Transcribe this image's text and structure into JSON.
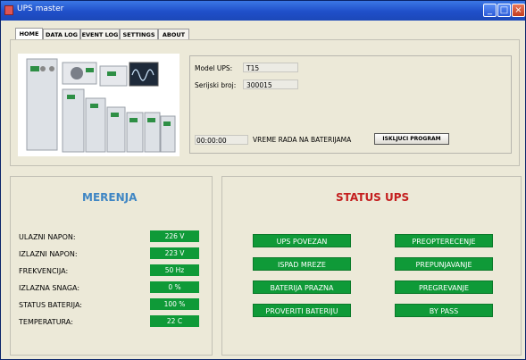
{
  "window": {
    "title": "UPS master"
  },
  "tabs": [
    "HOME",
    "DATA LOG",
    "EVENT LOG",
    "SETTINGS",
    "ABOUT"
  ],
  "info": {
    "model_label": "Model UPS:",
    "model_value": "T15",
    "serial_label": "Serijski broj:",
    "serial_value": "300015",
    "battery_time": "00:00:00",
    "battery_time_label": "VREME RADA NA BATERIJAMA",
    "exit_button": "ISKLJUCI PROGRAM"
  },
  "measurements": {
    "title": "MERENJA",
    "rows": [
      {
        "label": "ULAZNI NAPON:",
        "value": "226 V"
      },
      {
        "label": "IZLAZNI NAPON:",
        "value": "223 V"
      },
      {
        "label": "FREKVENCIJA:",
        "value": "50 Hz"
      },
      {
        "label": "IZLAZNA SNAGA:",
        "value": "0 %"
      },
      {
        "label": "STATUS BATERIJA:",
        "value": "100 %"
      },
      {
        "label": "TEMPERATURA:",
        "value": "22 C"
      }
    ]
  },
  "status": {
    "title": "STATUS UPS",
    "left": [
      "UPS POVEZAN",
      "ISPAD MREZE",
      "BATERIJA PRAZNA",
      "PROVERITI BATERIJU"
    ],
    "right": [
      "PREOPTERECENJE",
      "PREPUNJAVANJE",
      "PREGREVANJE",
      "BY PASS"
    ]
  },
  "colors": {
    "indicator_green": "#0f9a38",
    "merenja_blue": "#3f86c4",
    "status_red": "#c41e1e"
  }
}
